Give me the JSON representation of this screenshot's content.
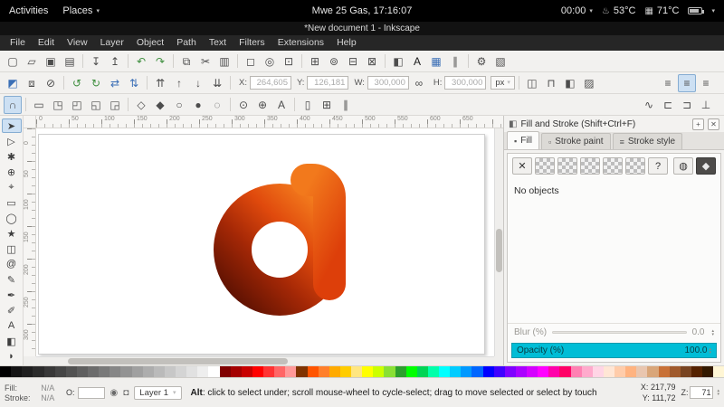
{
  "ui": {
    "spin_up": "▴",
    "spin_down": "▾"
  },
  "topbar": {
    "activities": "Activities",
    "places": "Places",
    "places_caret": "▾",
    "clock": "Mwe 25 Gas, 17:16:07",
    "timer": "00:00",
    "timer_caret": "▾",
    "thermo_icon": "♨",
    "chip_icon": "▦",
    "temp_cpu": "53°C",
    "temp_gpu": "71°C",
    "caret": "▾"
  },
  "window": {
    "title": "*New document 1 - Inkscape"
  },
  "menus": [
    "File",
    "Edit",
    "View",
    "Layer",
    "Object",
    "Path",
    "Text",
    "Filters",
    "Extensions",
    "Help"
  ],
  "commands_bar": [
    {
      "name": "document-new",
      "glyph": "▢"
    },
    {
      "name": "document-open",
      "glyph": "▱"
    },
    {
      "name": "document-save",
      "glyph": "▣"
    },
    {
      "name": "document-print",
      "glyph": "▤"
    },
    {
      "sep": true
    },
    {
      "name": "import",
      "glyph": "↧"
    },
    {
      "name": "export",
      "glyph": "↥"
    },
    {
      "sep": true
    },
    {
      "name": "undo",
      "glyph": "↶",
      "color": "#3f8f3f"
    },
    {
      "name": "redo",
      "glyph": "↷",
      "color": "#3f8f3f"
    },
    {
      "sep": true
    },
    {
      "name": "copy",
      "glyph": "⧉"
    },
    {
      "name": "cut",
      "glyph": "✂"
    },
    {
      "name": "paste",
      "glyph": "▥"
    },
    {
      "sep": true
    },
    {
      "name": "zoom-page",
      "glyph": "◻"
    },
    {
      "name": "zoom-drawing",
      "glyph": "◎"
    },
    {
      "name": "zoom-selection",
      "glyph": "⊡"
    },
    {
      "sep": true
    },
    {
      "name": "duplicate",
      "glyph": "⊞"
    },
    {
      "name": "create-clone",
      "glyph": "⊚"
    },
    {
      "name": "group",
      "glyph": "⊟"
    },
    {
      "name": "ungroup",
      "glyph": "⊠"
    },
    {
      "sep": true
    },
    {
      "name": "fill-stroke-dialog",
      "glyph": "◧"
    },
    {
      "name": "text-dialog",
      "glyph": "A",
      "color": "#1a1a1a"
    },
    {
      "name": "xml-editor",
      "glyph": "▦",
      "color": "#3b6fb6"
    },
    {
      "name": "align-dialog",
      "glyph": "∥"
    },
    {
      "sep": true
    },
    {
      "name": "preferences",
      "glyph": "⚙"
    },
    {
      "name": "document-properties",
      "glyph": "▧"
    }
  ],
  "selector_bar": {
    "left": [
      {
        "name": "select-all",
        "glyph": "◩",
        "color": "#3b6fb6"
      },
      {
        "name": "select-all-layers",
        "glyph": "⧈"
      },
      {
        "name": "deselect",
        "glyph": "⊘"
      },
      {
        "sep": true
      },
      {
        "name": "rotate-ccw",
        "glyph": "↺",
        "color": "#3f8f3f"
      },
      {
        "name": "rotate-cw",
        "glyph": "↻",
        "color": "#3f8f3f"
      },
      {
        "name": "flip-horizontal",
        "glyph": "⇄",
        "color": "#3b6fb6"
      },
      {
        "name": "flip-vertical",
        "glyph": "⇅",
        "color": "#3b6fb6"
      },
      {
        "sep": true
      },
      {
        "name": "raise-to-top",
        "glyph": "⇈"
      },
      {
        "name": "raise",
        "glyph": "↑"
      },
      {
        "name": "lower",
        "glyph": "↓"
      },
      {
        "name": "lower-to-bottom",
        "glyph": "⇊"
      },
      {
        "sep": true
      }
    ],
    "x_label": "X:",
    "x_value": "264,605",
    "y_label": "Y:",
    "y_value": "126,181",
    "w_label": "W:",
    "w_value": "300,000",
    "h_label": "H:",
    "h_value": "300,000",
    "lock_glyph": "∞",
    "unit": "px",
    "unit_caret": "▾",
    "affect": [
      {
        "name": "affect-stroke-toggle",
        "glyph": "◫"
      },
      {
        "name": "affect-corners-toggle",
        "glyph": "⊓"
      },
      {
        "name": "affect-gradient-toggle",
        "glyph": "◧"
      },
      {
        "name": "affect-pattern-toggle",
        "glyph": "▨"
      }
    ],
    "right": [
      {
        "name": "move-gradients-toggle",
        "glyph": "≡"
      },
      {
        "name": "move-patterns-toggle",
        "glyph": "≡",
        "active": true
      },
      {
        "name": "move-clips-toggle",
        "glyph": "≡"
      }
    ]
  },
  "snap_bar": {
    "items": [
      {
        "name": "snap-enable",
        "glyph": "∩",
        "active": true
      },
      {
        "sep": true
      },
      {
        "name": "snap-bbox",
        "glyph": "▭"
      },
      {
        "name": "snap-bbox-edges",
        "glyph": "◳"
      },
      {
        "name": "snap-bbox-corners",
        "glyph": "◰"
      },
      {
        "name": "snap-bbox-midpoints",
        "glyph": "◱"
      },
      {
        "name": "snap-bbox-centers",
        "glyph": "◲"
      },
      {
        "sep": true
      },
      {
        "name": "snap-nodes",
        "glyph": "◇"
      },
      {
        "name": "snap-intersections",
        "glyph": "◆"
      },
      {
        "name": "snap-cusp-nodes",
        "glyph": "○"
      },
      {
        "name": "snap-smooth-nodes",
        "glyph": "●"
      },
      {
        "name": "snap-midpoints",
        "glyph": "◌"
      },
      {
        "sep": true
      },
      {
        "name": "snap-object-centers",
        "glyph": "⊙"
      },
      {
        "name": "snap-rotation-centers",
        "glyph": "⊕"
      },
      {
        "name": "snap-text-baseline",
        "glyph": "A"
      },
      {
        "sep": true
      },
      {
        "name": "snap-page-border",
        "glyph": "▯"
      },
      {
        "name": "snap-grid",
        "glyph": "⊞"
      },
      {
        "name": "snap-guides",
        "glyph": "∥"
      }
    ],
    "right": [
      {
        "name": "snap-paths-toggle",
        "glyph": "∿"
      },
      {
        "name": "snap-alignment-toggle",
        "glyph": "⊏"
      },
      {
        "name": "snap-distribution-toggle",
        "glyph": "⊐"
      },
      {
        "name": "snap-perpendicular-toggle",
        "glyph": "⊥"
      }
    ]
  },
  "toolbox": [
    {
      "name": "tool-selector",
      "glyph": "➤",
      "active": true
    },
    {
      "name": "tool-node",
      "glyph": "▷"
    },
    {
      "name": "tool-tweak",
      "glyph": "✱"
    },
    {
      "name": "tool-zoom",
      "glyph": "⊕"
    },
    {
      "name": "tool-measure",
      "glyph": "⌖"
    },
    {
      "name": "tool-rectangle",
      "glyph": "▭"
    },
    {
      "name": "tool-ellipse",
      "glyph": "◯"
    },
    {
      "name": "tool-star",
      "glyph": "★"
    },
    {
      "name": "tool-3dbox",
      "glyph": "◫"
    },
    {
      "name": "tool-spiral",
      "glyph": "@"
    },
    {
      "name": "tool-pencil",
      "glyph": "✎"
    },
    {
      "name": "tool-pen",
      "glyph": "✒"
    },
    {
      "name": "tool-calligraphy",
      "glyph": "✐"
    },
    {
      "name": "tool-text",
      "glyph": "A"
    },
    {
      "name": "tool-gradient",
      "glyph": "◧"
    },
    {
      "name": "tool-dropper",
      "glyph": "◗"
    }
  ],
  "rulers": {
    "h": [
      "0",
      "50",
      "100",
      "150",
      "200",
      "250",
      "300",
      "350",
      "400",
      "450",
      "500",
      "550",
      "600",
      "650"
    ],
    "v": [
      "0",
      "50",
      "100",
      "150",
      "200",
      "250",
      "300"
    ]
  },
  "logo": {
    "ring_dark": "#5f1202",
    "ring_mid": "#a52806",
    "ring_hot": "#e04a0d",
    "ring_bright": "#f68420",
    "stem_top": "#f2791c",
    "stem_bottom": "#dd3f0a"
  },
  "dock": {
    "icon": "◧",
    "title": "Fill and Stroke (Shift+Ctrl+F)",
    "btn_float": "+",
    "btn_close": "✕",
    "tabs": [
      {
        "name": "tab-fill",
        "icon": "▪",
        "label": "Fill",
        "active": true
      },
      {
        "name": "tab-stroke-paint",
        "icon": "▫",
        "label": "Stroke paint"
      },
      {
        "name": "tab-stroke-style",
        "icon": "≡",
        "label": "Stroke style"
      }
    ],
    "paint_buttons": [
      {
        "name": "paint-none",
        "glyph": "✕"
      },
      {
        "name": "paint-flat",
        "checker": true
      },
      {
        "name": "paint-linear-gradient",
        "checker": true
      },
      {
        "name": "paint-radial-gradient",
        "checker": true
      },
      {
        "name": "paint-pattern",
        "checker": true
      },
      {
        "name": "paint-swatch",
        "checker": true
      },
      {
        "name": "paint-unknown",
        "glyph": "?"
      }
    ],
    "paint_right": [
      {
        "name": "paint-mesh",
        "glyph": "◍"
      },
      {
        "name": "paint-shield",
        "glyph": "◆",
        "pressed": true
      }
    ],
    "no_objects": "No objects",
    "blur_label": "Blur (%)",
    "blur_value": "0.0",
    "opacity_label": "Opacity (%)",
    "opacity_value": "100.0",
    "opacity_color": "#00bdd6"
  },
  "palette": {
    "colors": [
      "#000000",
      "#141414",
      "#1f1f1f",
      "#2b2b2b",
      "#383838",
      "#454545",
      "#525252",
      "#5f5f5f",
      "#6c6c6c",
      "#797979",
      "#868686",
      "#939393",
      "#a0a0a0",
      "#adadad",
      "#bababa",
      "#c7c7c7",
      "#d4d4d4",
      "#e1e1e1",
      "#eeeeee",
      "#ffffff",
      "#800000",
      "#a40000",
      "#c80000",
      "#ff0000",
      "#ff3333",
      "#ff6666",
      "#ff9999",
      "#803300",
      "#ff5500",
      "#ff7f2a",
      "#ffaa00",
      "#ffcc00",
      "#ffe680",
      "#ffff00",
      "#ccff00",
      "#89e034",
      "#2ca02c",
      "#00ff00",
      "#00d455",
      "#00ffaa",
      "#00ffff",
      "#00ccff",
      "#0099ff",
      "#0066ff",
      "#0000ff",
      "#3f00ff",
      "#7f00ff",
      "#aa00ff",
      "#d400ff",
      "#ff00ff",
      "#ff00aa",
      "#ff0066",
      "#ff80b2",
      "#ffaacc",
      "#ffd5e5",
      "#ffe6d5",
      "#ffccaa",
      "#ffb380",
      "#e9c6af",
      "#d9a679",
      "#c87137",
      "#a05a2c",
      "#784421",
      "#552200",
      "#331900",
      "#fff6d5"
    ]
  },
  "statusbar": {
    "fill_label": "Fill:",
    "fill_value": "N/A",
    "stroke_label": "Stroke:",
    "stroke_value": "N/A",
    "opacity_label": "O:",
    "opacity_value": "",
    "eye_glyph": "◉",
    "lock_glyph": "◘",
    "layer_label": "Layer 1",
    "layer_caret": "▾",
    "msg_bold": "Alt",
    "msg_rest": ": click to select under; scroll mouse-wheel to cycle-select; drag to move selected or select by touch",
    "x_label": "X:",
    "x_value": "217,79",
    "y_label": "Y:",
    "y_value": "111,72",
    "z_label": "Z:",
    "z_value": "71"
  }
}
